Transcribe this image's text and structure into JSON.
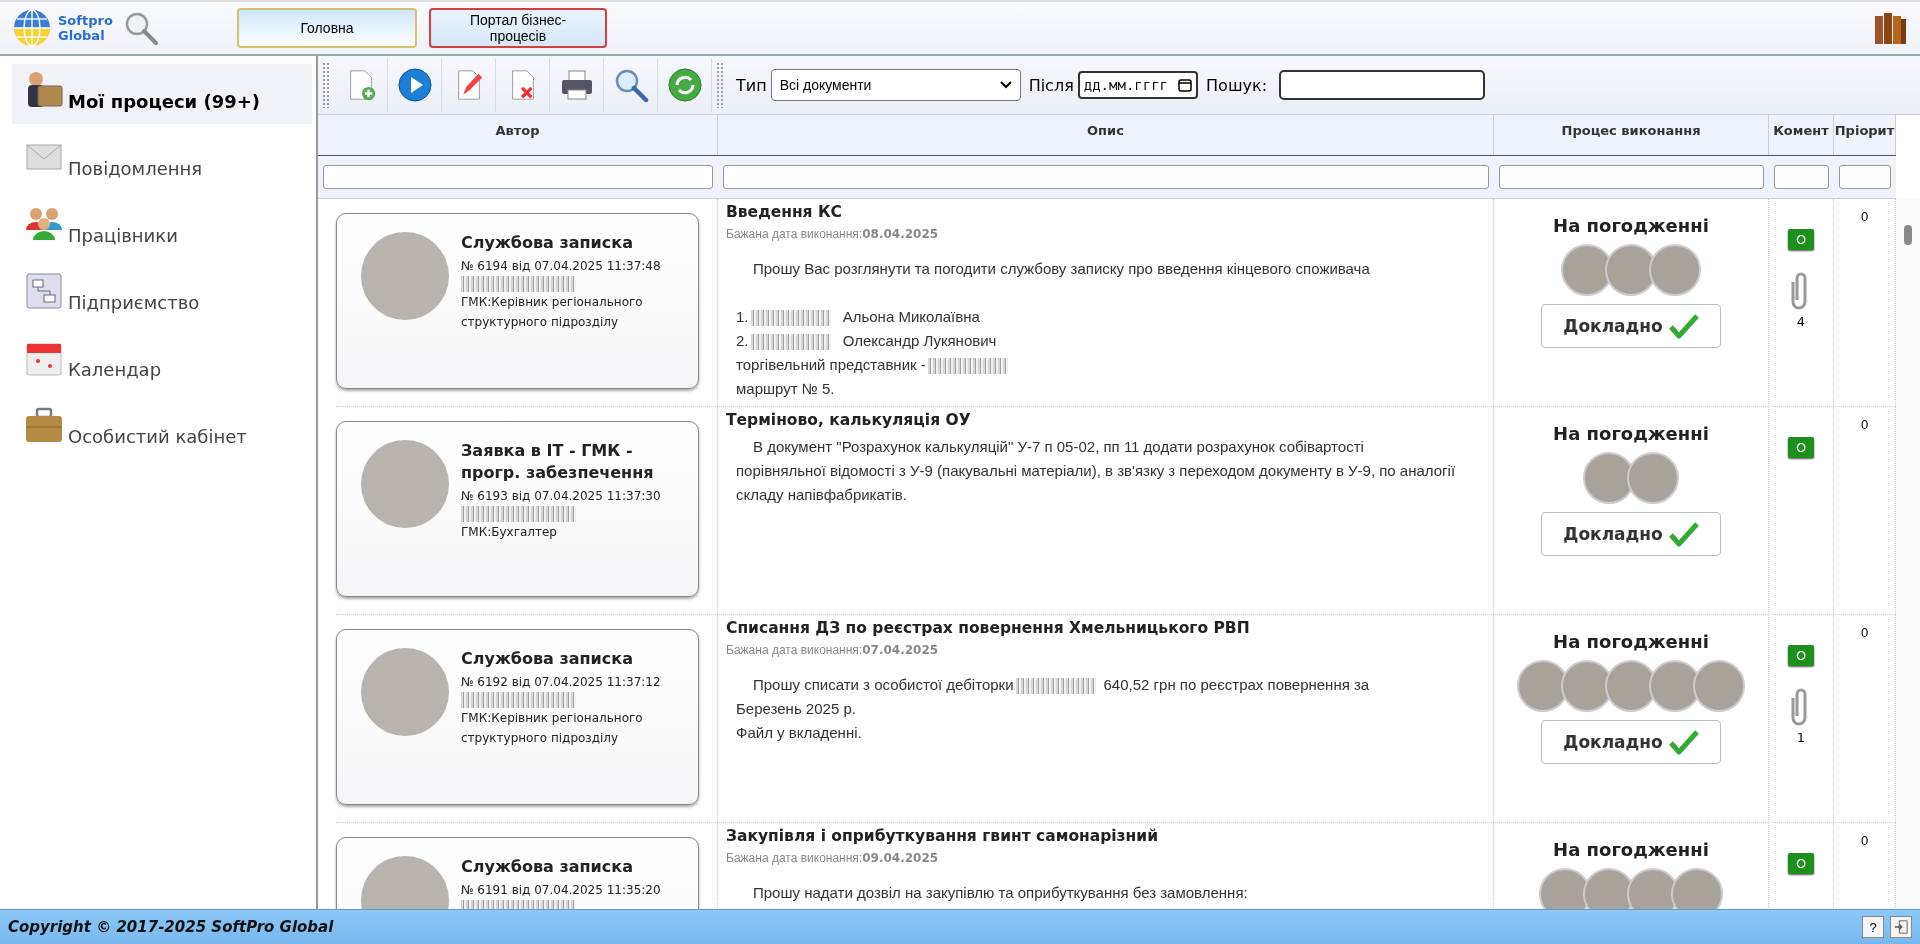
{
  "header": {
    "logo_lines": [
      "Softpro",
      "Global"
    ],
    "nav": [
      {
        "label": "Головна",
        "selected": false
      },
      {
        "label": "Портал бізнес-процесів",
        "selected": true
      }
    ]
  },
  "sidebar": {
    "items": [
      {
        "label": "Мої процеси (99+)",
        "selected": true
      },
      {
        "label": "Повідомлення",
        "selected": false
      },
      {
        "label": "Працівники",
        "selected": false
      },
      {
        "label": "Підприємство",
        "selected": false
      },
      {
        "label": "Календар",
        "selected": false
      },
      {
        "label": "Особистий кабінет",
        "selected": false
      }
    ]
  },
  "toolbar": {
    "type_label": "Тип",
    "type_value": "Всі документи",
    "after_label": "Після",
    "date_placeholder": "дд.мм.гггг",
    "search_label": "Пошук:"
  },
  "table": {
    "columns": [
      "Автор",
      "Опис",
      "Процес виконання",
      "Комент",
      "Пріорит"
    ],
    "rows": [
      {
        "author": {
          "doc_type": "Службова записка",
          "number": "№ 6194 від 07.04.2025 11:37:48",
          "name_hidden": true,
          "role": "ГМК:Керівник регіонального структурного підрозділу"
        },
        "title": "Введення КС",
        "due_label": "Бажана дата виконання:",
        "due_date": "08.04.2025",
        "body": [
          [
            {
              "kind": "text",
              "text": "Прошу Вас розглянути та погодити службову записку про введення кінцевого споживача"
            }
          ],
          [
            {
              "kind": "gap"
            }
          ],
          [
            {
              "kind": "text",
              "text": "1."
            },
            {
              "kind": "hidden"
            },
            {
              "kind": "text",
              "text": " Альона Миколаївна"
            }
          ],
          [
            {
              "kind": "text",
              "text": "2."
            },
            {
              "kind": "hidden"
            },
            {
              "kind": "text",
              "text": " Олександр Лукянович"
            }
          ],
          [
            {
              "kind": "text",
              "text": "торгівельний представник -"
            },
            {
              "kind": "hidden"
            }
          ],
          [
            {
              "kind": "text",
              "text": "маршрут № 5."
            }
          ]
        ],
        "status": "На погодженні",
        "approvers": [
          {
            "kind": "photo"
          },
          {
            "kind": "photo"
          },
          {
            "kind": "photo"
          }
        ],
        "details_button": "Докладно",
        "comment_badge": "O",
        "attachments": "4",
        "priority": "0"
      },
      {
        "author": {
          "doc_type": "Заявка в IT - ГМК - прогр. забезпечення",
          "number": "№ 6193 від 07.04.2025 11:37:30",
          "name_hidden": true,
          "role": "ГМК:Бухгалтер"
        },
        "title": "Терміново, калькуляція ОУ",
        "body": [
          [
            {
              "kind": "text",
              "text": "В документ \"Розрахунок калькуляцій\" У-7 п 05-02, пп 11 додати розрахунок собівартості порівняльної відомості з У-9 (пакувальні матеріали), в зв'язку з переходом документу в У-9, по аналогії складу напівфабрикатів."
            }
          ]
        ],
        "status": "На погодженні",
        "approvers": [
          {
            "kind": "photo"
          },
          {
            "kind": "photo"
          }
        ],
        "details_button": "Докладно",
        "comment_badge": "O",
        "priority": "0"
      },
      {
        "author": {
          "doc_type": "Службова записка",
          "number": "№ 6192 від 07.04.2025 11:37:12",
          "name_hidden": true,
          "role": "ГМК:Керівник регіонального структурного підрозділу"
        },
        "title": "Списання ДЗ по реєстрах повернення Хмельницького РВП",
        "due_label": "Бажана дата виконання:",
        "due_date": "07.04.2025",
        "body": [
          [
            {
              "kind": "text",
              "text": "Прошу списати з особистої дебіторки"
            },
            {
              "kind": "hidden"
            },
            {
              "kind": "text",
              "text": "640,52  грн по реєстрах повернення за"
            }
          ],
          [
            {
              "kind": "text",
              "text": "Березень 2025 р."
            }
          ],
          [
            {
              "kind": "text",
              "text": "Файл у вкладенні."
            }
          ]
        ],
        "status": "На погодженні",
        "approvers": [
          {
            "kind": "photo"
          },
          {
            "kind": "photo"
          },
          {
            "kind": "photo"
          },
          {
            "kind": "photo"
          },
          {
            "kind": "photo"
          }
        ],
        "details_button": "Докладно",
        "comment_badge": "O",
        "attachments": "1",
        "priority": "0"
      },
      {
        "author": {
          "doc_type": "Службова записка",
          "number": "№ 6191 від 07.04.2025 11:35:20",
          "name_hidden": true
        },
        "title": "Закупівля і оприбуткування гвинт самонарізний",
        "due_label": "Бажана дата виконання:",
        "due_date": "09.04.2025",
        "body": [
          [
            {
              "kind": "text",
              "text": "Прошу надати дозвіл на закупівлю та оприбуткування без замовлення:"
            }
          ]
        ],
        "status": "На погодженні",
        "approvers": [
          {
            "kind": "photo"
          },
          {
            "kind": "photo"
          },
          {
            "kind": "photo"
          },
          {
            "kind": "photo"
          }
        ],
        "comment_badge": "O",
        "priority": "0"
      }
    ]
  },
  "footer": {
    "copyright": "Copyright © 2017-2025 SoftPro Global",
    "help_label": "?"
  }
}
